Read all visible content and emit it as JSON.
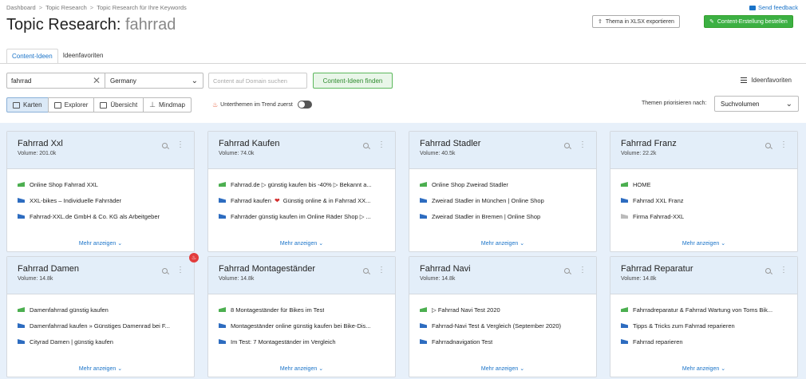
{
  "breadcrumb": [
    "Dashboard",
    "Topic Research",
    "Topic Research für Ihre Keywords"
  ],
  "title": {
    "prefix": "Topic Research:",
    "keyword": "fahrrad"
  },
  "feedback": "Send feedback",
  "export_label": "Thema in XLSX exportieren",
  "order_label": "Content-Erstellung bestellen",
  "tabs": [
    "Content-Ideen",
    "Ideenfavoriten"
  ],
  "search": {
    "value": "fahrrad",
    "db": "Germany",
    "domain_placeholder": "Content auf Domain suchen",
    "find_label": "Content-Ideen finden"
  },
  "favs_label": "Ideenfavoriten",
  "views": [
    "Karten",
    "Explorer",
    "Übersicht",
    "Mindmap"
  ],
  "trend_label": "Unterthemen im Trend zuerst",
  "prio": {
    "label": "Themen priorisieren nach:",
    "value": "Suchvolumen"
  },
  "more_label": "Mehr anzeigen",
  "colors": {
    "accent": "#1a73c8",
    "green": "#3cb043",
    "card_head": "#e3eef9",
    "area_bg": "#e7f0fa"
  },
  "cards": [
    {
      "title": "Fahrrad Xxl",
      "volume": "Volume: 201.0k",
      "headlines": [
        {
          "icon": "green",
          "text": "Online Shop Fahrrad XXL"
        },
        {
          "icon": "blue",
          "text": "XXL-bikes – Individuelle Fahrräder"
        },
        {
          "icon": "blue",
          "text": "Fahrrad-XXL.de GmbH & Co. KG als Arbeitgeber"
        }
      ]
    },
    {
      "title": "Fahrrad Kaufen",
      "volume": "Volume: 74.0k",
      "headlines": [
        {
          "icon": "green",
          "text": "Fahrrad.de ▷ günstig kaufen bis -40% ▷ Bekannt a..."
        },
        {
          "icon": "blue",
          "text": "Fahrrad kaufen ❤ Günstig online & in Fahrrad XX..."
        },
        {
          "icon": "blue",
          "text": "Fahrräder günstig kaufen im Online Räder Shop ▷ ..."
        }
      ]
    },
    {
      "title": "Fahrrad Stadler",
      "volume": "Volume: 40.5k",
      "headlines": [
        {
          "icon": "green",
          "text": "Online Shop Zweirad Stadler"
        },
        {
          "icon": "blue",
          "text": "Zweirad Stadler in München | Online Shop"
        },
        {
          "icon": "blue",
          "text": "Zweirad Stadler in Bremen | Online Shop"
        }
      ]
    },
    {
      "title": "Fahrrad Franz",
      "volume": "Volume: 22.2k",
      "headlines": [
        {
          "icon": "green",
          "text": "HOME"
        },
        {
          "icon": "blue",
          "text": "Fahrrad XXL Franz"
        },
        {
          "icon": "gray",
          "text": "Firma Fahrrad-XXL"
        }
      ]
    },
    {
      "title": "Fahrrad Damen",
      "volume": "Volume: 14.8k",
      "trending": true,
      "headlines": [
        {
          "icon": "green",
          "text": "Damenfahrrad günstig kaufen"
        },
        {
          "icon": "blue",
          "text": "Damenfahrrad kaufen » Günstiges Damenrad bei F..."
        },
        {
          "icon": "blue",
          "text": "Cityrad Damen | günstig kaufen"
        }
      ]
    },
    {
      "title": "Fahrrad Montageständer",
      "volume": "Volume: 14.8k",
      "headlines": [
        {
          "icon": "green",
          "text": "8 Montageständer für Bikes im Test"
        },
        {
          "icon": "blue",
          "text": "Montageständer online günstig kaufen bei Bike-Dis..."
        },
        {
          "icon": "blue",
          "text": "Im Test: 7 Montageständer im Vergleich"
        }
      ]
    },
    {
      "title": "Fahrrad Navi",
      "volume": "Volume: 14.8k",
      "headlines": [
        {
          "icon": "green",
          "text": "▷ Fahrrad Navi Test 2020"
        },
        {
          "icon": "blue",
          "text": "Fahrrad-Navi Test & Vergleich (September 2020)"
        },
        {
          "icon": "blue",
          "text": "Fahrradnavigation Test"
        }
      ]
    },
    {
      "title": "Fahrrad Reparatur",
      "volume": "Volume: 14.8k",
      "headlines": [
        {
          "icon": "green",
          "text": "Fahrradreparatur & Fahrrad Wartung von Toms Bik..."
        },
        {
          "icon": "blue",
          "text": "Tipps & Tricks zum Fahrrad reparieren"
        },
        {
          "icon": "blue",
          "text": "Fahrrad reparieren"
        }
      ]
    }
  ]
}
